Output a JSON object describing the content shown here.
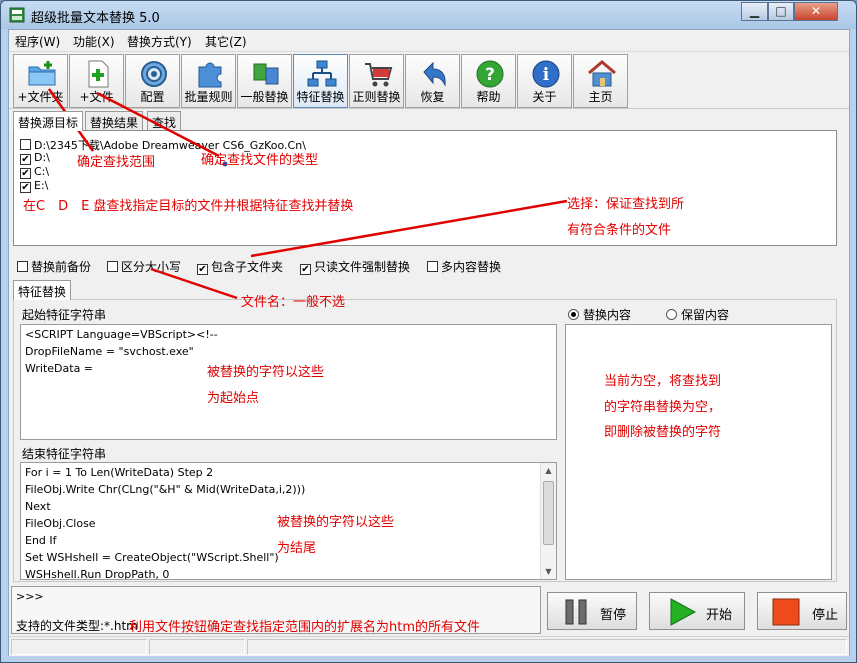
{
  "window": {
    "title": "超级批量文本替换 5.0",
    "controls": {
      "minimize": "▁",
      "maximize": "□",
      "close": "✕"
    }
  },
  "menu": [
    "程序(W)",
    "功能(X)",
    "替换方式(Y)",
    "其它(Z)"
  ],
  "toolbar": [
    {
      "label": "+文件夹",
      "icon": "folder-add-icon"
    },
    {
      "label": "+文件",
      "icon": "file-add-icon"
    },
    {
      "label": "配置",
      "icon": "gear-icon"
    },
    {
      "label": "批量规则",
      "icon": "puzzle-icon"
    },
    {
      "label": "一般替换",
      "icon": "swap-icon"
    },
    {
      "label": "特征替换",
      "icon": "network-icon"
    },
    {
      "label": "正则替换",
      "icon": "cart-icon"
    },
    {
      "label": "恢复",
      "icon": "undo-icon"
    },
    {
      "label": "帮助",
      "icon": "help-icon"
    },
    {
      "label": "关于",
      "icon": "info-icon"
    },
    {
      "label": "主页",
      "icon": "home-icon"
    }
  ],
  "top_tabs": [
    "替换源目标",
    "替换结果",
    "查找"
  ],
  "targets": [
    {
      "path": "D:\\2345下载\\Adobe Dreamweaver CS6_GzKoo.Cn\\",
      "checked": false
    },
    {
      "path": "D:\\",
      "checked": true
    },
    {
      "path": "C:\\",
      "checked": true
    },
    {
      "path": "E:\\",
      "checked": true
    }
  ],
  "options": [
    {
      "label": "替换前备份",
      "checked": false
    },
    {
      "label": "区分大小写",
      "checked": false
    },
    {
      "label": "包含子文件夹",
      "checked": true
    },
    {
      "label": "只读文件强制替换",
      "checked": true
    },
    {
      "label": "多内容替换",
      "checked": false
    }
  ],
  "feature_tab": "特征替换",
  "start_group": {
    "title": "起始特征字符串",
    "lines": [
      "<SCRIPT Language=VBScript><!--",
      "DropFileName = \"svchost.exe\"",
      "WriteData ="
    ]
  },
  "end_group": {
    "title": "结束特征字符串",
    "lines": [
      "For i = 1 To Len(WriteData) Step 2",
      "FileObj.Write Chr(CLng(\"&H\" & Mid(WriteData,i,2)))",
      "Next",
      "FileObj.Close",
      "End If",
      "Set WSHshell = CreateObject(\"WScript.Shell\")",
      "WSHshell.Run DropPath, 0"
    ]
  },
  "replace_mode": {
    "replace_label": "替换内容",
    "keep_label": "保留内容",
    "selected": "replace"
  },
  "log": {
    "prompt": ">>>",
    "filetype_label": "支持的文件类型:",
    "filetype_value": "*.htm"
  },
  "actions": {
    "pause": "暂停",
    "start": "开始",
    "stop": "停止"
  },
  "annotations": {
    "scope": "确定查找范围",
    "file_type": "确定查找文件的类型",
    "drives": "在C　D　E 盘查找指定目标的文件并根据特征查找并替换",
    "select_line1": "选择：保证查找到所",
    "select_line2": "有符合条件的文件",
    "filename": "文件名：一般不选",
    "start_line1": "被替换的字符以这些",
    "start_line2": "为起始点",
    "empty_line1": "当前为空，将查找到",
    "empty_line2": "的字符串替换为空，",
    "empty_line3": "即删除被替换的字符",
    "end_line1": "被替换的字符以这些",
    "end_line2": "为结尾",
    "bottom": "利用文件按钮确定查找指定范围内的扩展名为htm的所有文件"
  },
  "colors": {
    "annotation": "#e10000",
    "title_bar": "#b9d1ea"
  }
}
